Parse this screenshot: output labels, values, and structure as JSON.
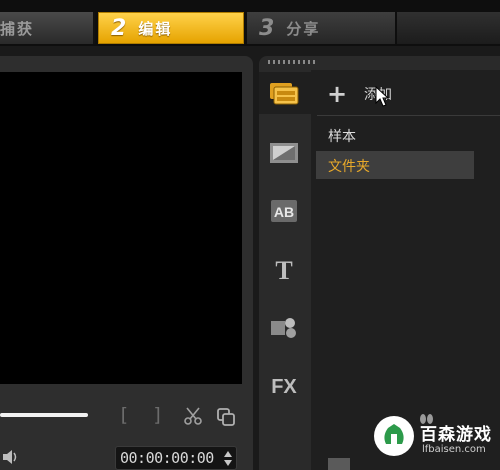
{
  "steps": [
    {
      "number": "",
      "label": "捕获"
    },
    {
      "number": "2",
      "label": "编辑"
    },
    {
      "number": "3",
      "label": "分享"
    }
  ],
  "player": {
    "bracket_in": "[",
    "bracket_out": "]",
    "timecode": "00:00:00:00",
    "progress": 0.35
  },
  "library": {
    "add_label": "添加",
    "items": [
      "样本",
      "文件夹"
    ],
    "selected_item": "文件夹",
    "tabs": [
      "media-icon",
      "transition-icon",
      "title-ab-icon",
      "text-t-icon",
      "graphics-icon",
      "fx-icon"
    ],
    "fx_label": "FX",
    "ab_label": "AB",
    "t_label": "T"
  },
  "watermark": {
    "name": "百森游戏",
    "url": "lfbaisen.com"
  },
  "colors": {
    "active_step": "#f5b800",
    "selected_text": "#e8a92a",
    "background": "#1a1a1a"
  }
}
